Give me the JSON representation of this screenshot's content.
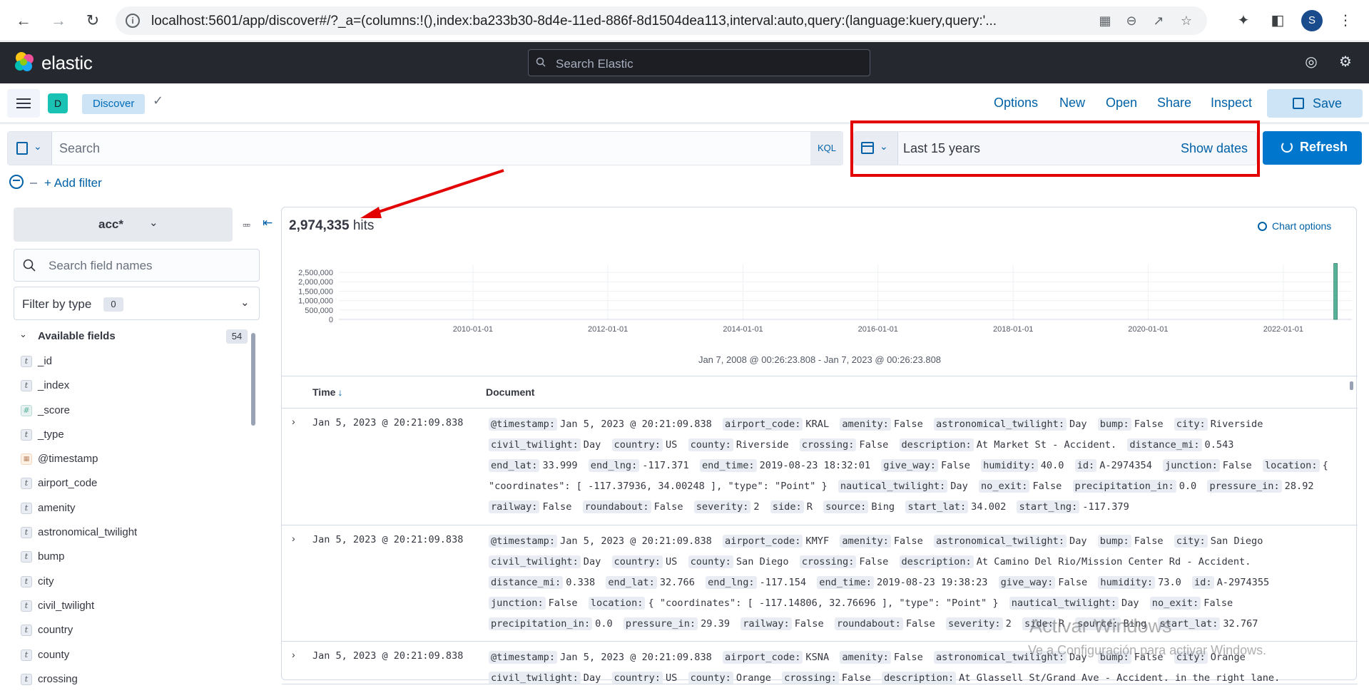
{
  "browser": {
    "url": "localhost:5601/app/discover#/?_a=(columns:!(),index:ba233b30-8d4e-11ed-886f-8d1504dea113,interval:auto,query:(language:kuery,query:'...",
    "profile_initial": "S"
  },
  "elastic_header": {
    "brand": "elastic",
    "search_placeholder": "Search Elastic"
  },
  "app_bar": {
    "space_initial": "D",
    "breadcrumb": "Discover",
    "links": [
      "Options",
      "New",
      "Open",
      "Share",
      "Inspect"
    ],
    "save_label": "Save"
  },
  "query_bar": {
    "placeholder": "Search",
    "language_button": "KQL",
    "time_range": "Last 15 years",
    "show_dates": "Show dates",
    "refresh_label": "Refresh",
    "add_filter": "+ Add filter"
  },
  "sidebar": {
    "index_pattern": "acc*",
    "field_search_placeholder": "Search field names",
    "filter_by_type": "Filter by type",
    "filter_count": "0",
    "available_fields_label": "Available fields",
    "available_fields_count": "54",
    "fields": [
      {
        "name": "_id",
        "type": "t",
        "kind": "string"
      },
      {
        "name": "_index",
        "type": "t",
        "kind": "string"
      },
      {
        "name": "_score",
        "type": "#",
        "kind": "number"
      },
      {
        "name": "_type",
        "type": "t",
        "kind": "string"
      },
      {
        "name": "@timestamp",
        "type": "▦",
        "kind": "date"
      },
      {
        "name": "airport_code",
        "type": "t",
        "kind": "string"
      },
      {
        "name": "amenity",
        "type": "t",
        "kind": "string"
      },
      {
        "name": "astronomical_twilight",
        "type": "t",
        "kind": "string"
      },
      {
        "name": "bump",
        "type": "t",
        "kind": "string"
      },
      {
        "name": "city",
        "type": "t",
        "kind": "string"
      },
      {
        "name": "civil_twilight",
        "type": "t",
        "kind": "string"
      },
      {
        "name": "country",
        "type": "t",
        "kind": "string"
      },
      {
        "name": "county",
        "type": "t",
        "kind": "string"
      },
      {
        "name": "crossing",
        "type": "t",
        "kind": "string"
      }
    ]
  },
  "results": {
    "hits_count": "2,974,335",
    "hits_label": "hits",
    "chart_options": "Chart options",
    "time_range_label": "Jan 7, 2008 @ 00:26:23.808 - Jan 7, 2023 @ 00:26:23.808",
    "column_time": "Time",
    "column_document": "Document",
    "rows": [
      {
        "time": "Jan 5, 2023 @ 20:21:09.838",
        "fields": [
          [
            "@timestamp:",
            "Jan 5, 2023 @ 20:21:09.838"
          ],
          [
            "airport_code:",
            "KRAL"
          ],
          [
            "amenity:",
            "False"
          ],
          [
            "astronomical_twilight:",
            "Day"
          ],
          [
            "bump:",
            "False"
          ],
          [
            "city:",
            "Riverside"
          ],
          [
            "civil_twilight:",
            "Day"
          ],
          [
            "country:",
            "US"
          ],
          [
            "county:",
            "Riverside"
          ],
          [
            "crossing:",
            "False"
          ],
          [
            "description:",
            "At Market St - Accident."
          ],
          [
            "distance_mi:",
            "0.543"
          ],
          [
            "end_lat:",
            "33.999"
          ],
          [
            "end_lng:",
            "-117.371"
          ],
          [
            "end_time:",
            "2019-08-23 18:32:01"
          ],
          [
            "give_way:",
            "False"
          ],
          [
            "humidity:",
            "40.0"
          ],
          [
            "id:",
            "A-2974354"
          ],
          [
            "junction:",
            "False"
          ],
          [
            "location:",
            "{ \"coordinates\": [ -117.37936, 34.00248 ], \"type\": \"Point\" }"
          ],
          [
            "nautical_twilight:",
            "Day"
          ],
          [
            "no_exit:",
            "False"
          ],
          [
            "precipitation_in:",
            "0.0"
          ],
          [
            "pressure_in:",
            "28.92"
          ],
          [
            "railway:",
            "False"
          ],
          [
            "roundabout:",
            "False"
          ],
          [
            "severity:",
            "2"
          ],
          [
            "side:",
            "R"
          ],
          [
            "source:",
            "Bing"
          ],
          [
            "start_lat:",
            "34.002"
          ],
          [
            "start_lng:",
            "-117.379"
          ]
        ]
      },
      {
        "time": "Jan 5, 2023 @ 20:21:09.838",
        "fields": [
          [
            "@timestamp:",
            "Jan 5, 2023 @ 20:21:09.838"
          ],
          [
            "airport_code:",
            "KMYF"
          ],
          [
            "amenity:",
            "False"
          ],
          [
            "astronomical_twilight:",
            "Day"
          ],
          [
            "bump:",
            "False"
          ],
          [
            "city:",
            "San Diego"
          ],
          [
            "civil_twilight:",
            "Day"
          ],
          [
            "country:",
            "US"
          ],
          [
            "county:",
            "San Diego"
          ],
          [
            "crossing:",
            "False"
          ],
          [
            "description:",
            "At Camino Del Rio/Mission Center Rd - Accident."
          ],
          [
            "distance_mi:",
            "0.338"
          ],
          [
            "end_lat:",
            "32.766"
          ],
          [
            "end_lng:",
            "-117.154"
          ],
          [
            "end_time:",
            "2019-08-23 19:38:23"
          ],
          [
            "give_way:",
            "False"
          ],
          [
            "humidity:",
            "73.0"
          ],
          [
            "id:",
            "A-2974355"
          ],
          [
            "junction:",
            "False"
          ],
          [
            "location:",
            "{ \"coordinates\": [ -117.14806, 32.76696 ], \"type\": \"Point\" }"
          ],
          [
            "nautical_twilight:",
            "Day"
          ],
          [
            "no_exit:",
            "False"
          ],
          [
            "precipitation_in:",
            "0.0"
          ],
          [
            "pressure_in:",
            "29.39"
          ],
          [
            "railway:",
            "False"
          ],
          [
            "roundabout:",
            "False"
          ],
          [
            "severity:",
            "2"
          ],
          [
            "side:",
            "R"
          ],
          [
            "source:",
            "Bing"
          ],
          [
            "start_lat:",
            "32.767"
          ]
        ]
      },
      {
        "time": "Jan 5, 2023 @ 20:21:09.838",
        "fields": [
          [
            "@timestamp:",
            "Jan 5, 2023 @ 20:21:09.838"
          ],
          [
            "airport_code:",
            "KSNA"
          ],
          [
            "amenity:",
            "False"
          ],
          [
            "astronomical_twilight:",
            "Day"
          ],
          [
            "bump:",
            "False"
          ],
          [
            "city:",
            "Orange"
          ],
          [
            "civil_twilight:",
            "Day"
          ],
          [
            "country:",
            "US"
          ],
          [
            "county:",
            "Orange"
          ],
          [
            "crossing:",
            "False"
          ],
          [
            "description:",
            "At Glassell St/Grand Ave - Accident. in the right lane."
          ]
        ]
      }
    ]
  },
  "chart_data": {
    "type": "bar",
    "y_ticks": [
      "2,500,000",
      "2,000,000",
      "1,500,000",
      "1,000,000",
      "500,000",
      "0"
    ],
    "x_ticks": [
      "2010-01-01",
      "2012-01-01",
      "2014-01-01",
      "2016-01-01",
      "2018-01-01",
      "2020-01-01",
      "2022-01-01"
    ],
    "xlim": [
      "2008-01-07",
      "2023-01-07"
    ],
    "ylim": [
      0,
      2974335
    ],
    "series": [
      {
        "x": "2022-10-01",
        "y": 2974335
      }
    ],
    "bar_color": "#54b399"
  },
  "watermark": {
    "title": "Activar Windows",
    "subtitle": "Ve a Configuración para activar Windows."
  }
}
